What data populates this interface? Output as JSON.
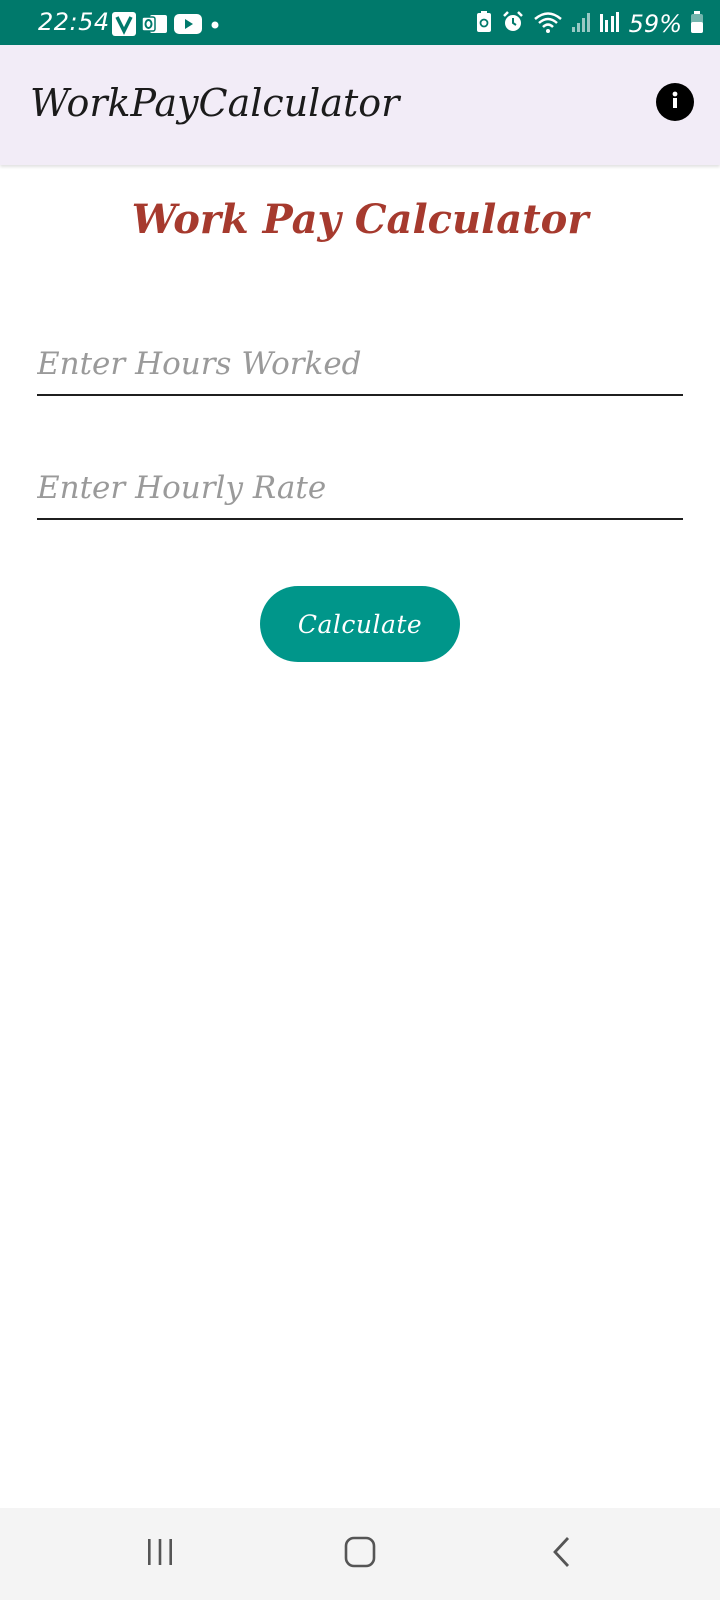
{
  "status_bar": {
    "time": "22:54",
    "battery": "59%",
    "background_color": "#00796b"
  },
  "app_bar": {
    "title": "WorkPayCalculator",
    "info_icon": "info-icon",
    "background_color": "#f2ecf7"
  },
  "main": {
    "heading": "Work Pay Calculator",
    "heading_color": "#a63a2e",
    "hours_field": {
      "placeholder": "Enter Hours Worked",
      "value": ""
    },
    "rate_field": {
      "placeholder": "Enter Hourly Rate",
      "value": ""
    },
    "calculate_label": "Calculate",
    "button_color": "#00968a"
  },
  "nav_bar": {
    "recents_icon": "recents-icon",
    "home_icon": "home-icon",
    "back_icon": "back-icon"
  }
}
